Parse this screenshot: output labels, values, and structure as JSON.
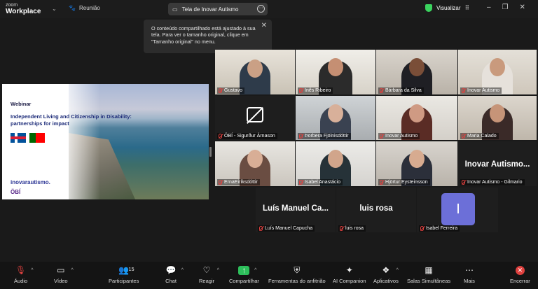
{
  "app": {
    "product": "zoom",
    "title": "Workplace"
  },
  "topbar": {
    "meeting_label": "Reunião",
    "share_pill": "Tela de Inovar Autismo",
    "view_label": "Visualizar"
  },
  "tooltip": {
    "text": "O conteúdo compartilhado está ajustado à sua tela. Para ver o tamanho original, clique em \"Tamanho original\" no menu."
  },
  "slide": {
    "kicker": "Webinar",
    "title": "Independent Living and Citizenship in Disability: partnerships for impact",
    "brand1": "inovarautismo.",
    "brand2": "ÖBÍ"
  },
  "participants": [
    {
      "name": "Gustavo"
    },
    {
      "name": "Inês Ribeiro"
    },
    {
      "name": "Bárbara da Silva"
    },
    {
      "name": "Inovar Autismo"
    },
    {
      "name": "ÖBÍ - Sigurður Árnason"
    },
    {
      "name": "Þorbera Fjölnisdóttir"
    },
    {
      "name": "Inovar Autismo"
    },
    {
      "name": "Maria Calado"
    },
    {
      "name": "ErnaEiríksdóttir"
    },
    {
      "name": "Isabel Anastácio"
    },
    {
      "name": "Hjörtur Eysteinsson"
    },
    {
      "name": "Inovar Autismo - Gilmario",
      "big": "Inovar Autismo..."
    },
    {
      "name": "Luís Manuel Capucha",
      "big": "Luís Manuel Ca..."
    },
    {
      "name": "luis rosa",
      "big": "luis rosa"
    },
    {
      "name": "Isabel Ferreira",
      "initial": "I"
    }
  ],
  "toolbar": {
    "audio": "Áudio",
    "video": "Vídeo",
    "participants": "Participantes",
    "participants_count": "15",
    "chat": "Chat",
    "react": "Reagir",
    "share": "Compartilhar",
    "host_tools": "Ferramentas do anfitrião",
    "ai": "AI Companion",
    "apps": "Aplicativos",
    "breakout": "Salas Simultâneas",
    "more": "Mais",
    "end": "Encerrar"
  },
  "colors": {
    "accent_green": "#2dbf5b",
    "mute_red": "#e0413f",
    "avatar_purple": "#6c6fd8"
  }
}
